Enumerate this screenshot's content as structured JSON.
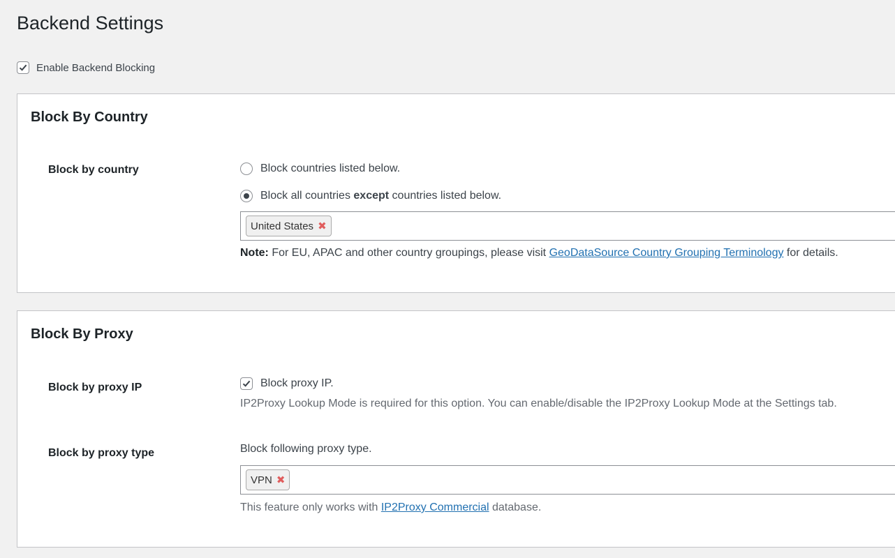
{
  "page": {
    "title": "Backend Settings"
  },
  "enable_backend": {
    "label": "Enable Backend Blocking",
    "checked": true
  },
  "country_section": {
    "title": "Block By Country",
    "row_label": "Block by country",
    "radio_1": "Block countries listed below.",
    "radio_2_pre": "Block all countries ",
    "radio_2_bold": "except",
    "radio_2_post": " countries listed below.",
    "selected_option": "radio_2",
    "tags": [
      "United States"
    ],
    "note_label": "Note:",
    "note_text": " For EU, APAC and other country groupings, please visit ",
    "note_link": "GeoDataSource Country Grouping Terminology",
    "note_suffix": " for details."
  },
  "proxy_section": {
    "title": "Block By Proxy",
    "ip_label": "Block by proxy IP",
    "ip_checkbox_label": "Block proxy IP.",
    "ip_checked": true,
    "ip_help": "IP2Proxy Lookup Mode is required for this option. You can enable/disable the IP2Proxy Lookup Mode at the Settings tab.",
    "type_label": "Block by proxy type",
    "type_intro": "Block following proxy type.",
    "type_tags": [
      "VPN"
    ],
    "type_help_pre": "This feature only works with ",
    "type_help_link": "IP2Proxy Commercial",
    "type_help_post": " database."
  },
  "colors": {
    "link": "#2271b1",
    "tag_remove": "#e05d5d",
    "border": "#c3c4c7"
  }
}
